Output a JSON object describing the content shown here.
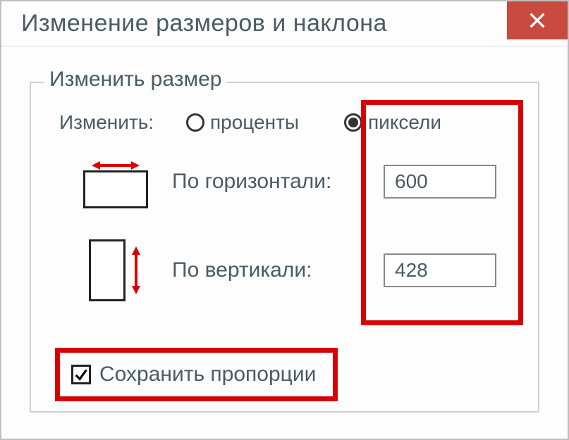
{
  "window": {
    "title": "Изменение размеров и наклона"
  },
  "group": {
    "title": "Изменить размер",
    "unit_label": "Изменить:",
    "radio_percent": "проценты",
    "radio_pixels": "пиксели",
    "horizontal_label": "По горизонтали:",
    "vertical_label": "По вертикали:",
    "horizontal_value": "600",
    "vertical_value": "428",
    "keep_aspect": "Сохранить пропорции"
  }
}
